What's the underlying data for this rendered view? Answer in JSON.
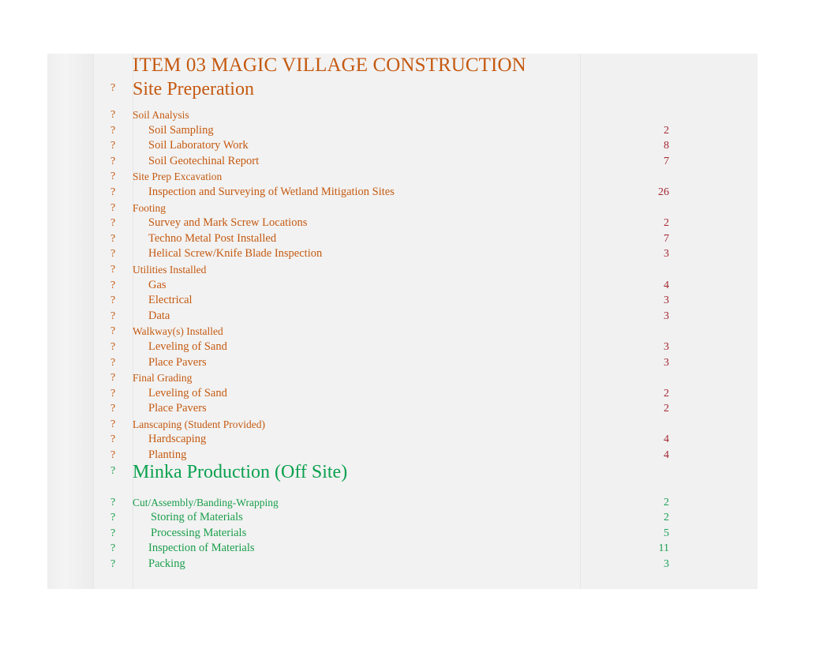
{
  "document": {
    "title": "ITEM 03 MAGIC VILLAGE CONSTRUCTION",
    "bullet_glyph": "?",
    "colors": {
      "orange": "#C55A11",
      "green": "#0AA14F",
      "number_red": "#A52833",
      "number_green": "#1AA055",
      "sheet_background": "#F2F2F2"
    }
  },
  "sections": [
    {
      "heading": "Site Preperation",
      "color": "orange",
      "rows": [
        {
          "type": "group",
          "label": "Soil Analysis",
          "value": ""
        },
        {
          "type": "task",
          "label": "Soil Sampling",
          "value": "2"
        },
        {
          "type": "task",
          "label": "Soil Laboratory Work",
          "value": "8"
        },
        {
          "type": "task",
          "label": "Soil Geotechinal Report",
          "value": "7"
        },
        {
          "type": "group",
          "label": "Site Prep Excavation",
          "value": ""
        },
        {
          "type": "task",
          "label": "Inspection and Surveying of Wetland Mitigation Sites",
          "value": "26"
        },
        {
          "type": "group",
          "label": "Footing",
          "value": ""
        },
        {
          "type": "task",
          "label": "Survey and Mark Screw Locations",
          "value": "2"
        },
        {
          "type": "task",
          "label": "Techno Metal Post Installed",
          "value": "7"
        },
        {
          "type": "task",
          "label": "Helical Screw/Knife Blade Inspection",
          "value": "3"
        },
        {
          "type": "group",
          "label": "Utilities Installed",
          "value": ""
        },
        {
          "type": "task",
          "label": "Gas",
          "value": "4"
        },
        {
          "type": "task",
          "label": "Electrical",
          "value": "3"
        },
        {
          "type": "task",
          "label": "Data",
          "value": "3"
        },
        {
          "type": "group",
          "label": "Walkway(s) Installed",
          "value": ""
        },
        {
          "type": "task",
          "label": "Leveling of Sand",
          "value": "3"
        },
        {
          "type": "task",
          "label": "Place Pavers",
          "value": "3"
        },
        {
          "type": "group",
          "label": "Final Grading",
          "value": ""
        },
        {
          "type": "task",
          "label": "Leveling of Sand",
          "value": "2"
        },
        {
          "type": "task",
          "label": "Place Pavers",
          "value": "2"
        },
        {
          "type": "group",
          "label": "Lanscaping (Student Provided)",
          "value": ""
        },
        {
          "type": "task",
          "label": "Hardscaping",
          "value": "4"
        },
        {
          "type": "task",
          "label": "Planting",
          "value": "4"
        }
      ]
    },
    {
      "heading": "Minka Production (Off Site)",
      "color": "green",
      "rows": [
        {
          "type": "group",
          "label": "Cut/Assembly/Banding-Wrapping",
          "value": "2"
        },
        {
          "type": "task",
          "label": "Storing of Materials",
          "value": "2"
        },
        {
          "type": "task",
          "label": "Processing Materials",
          "value": "5"
        },
        {
          "type": "task",
          "label": "Inspection of Materials",
          "value": "11"
        },
        {
          "type": "task",
          "label": "Packing",
          "value": "3"
        }
      ]
    }
  ]
}
